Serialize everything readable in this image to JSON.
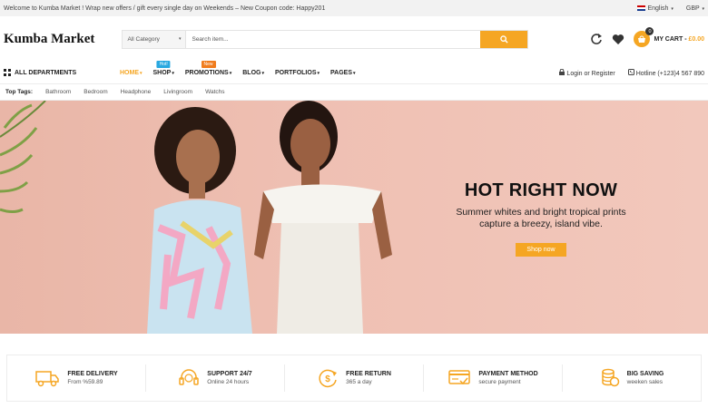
{
  "topbar": {
    "welcome": "Welcome to Kumba Market ! Wrap new offers / gift every single day on Weekends – New Coupon code: Happy201",
    "language": "English",
    "currency": "GBP"
  },
  "header": {
    "logo": "Kumba Market",
    "search_category": "All Category",
    "search_placeholder": "Search item...",
    "cart_count": "0",
    "cart_label": "MY CART - ",
    "cart_price": "£0.00"
  },
  "nav": {
    "all_departments": "ALL DEPARTMENTS",
    "items": [
      {
        "label": "HOME",
        "badge": ""
      },
      {
        "label": "SHOP",
        "badge": "Hot!"
      },
      {
        "label": "PROMOTIONS",
        "badge": "New"
      },
      {
        "label": "BLOG",
        "badge": ""
      },
      {
        "label": "PORTFOLIOS",
        "badge": ""
      },
      {
        "label": "PAGES",
        "badge": ""
      }
    ],
    "login": "Login or Register",
    "hotline": "Hotline (+123)4 567 890"
  },
  "tags": {
    "label": "Top Tags:",
    "items": [
      "Bathroom",
      "Bedroom",
      "Headphone",
      "Livingroom",
      "Watchs"
    ]
  },
  "hero": {
    "title": "HOT RIGHT NOW",
    "subtitle_line1": "Summer whites and bright tropical prints",
    "subtitle_line2": "capture a breezy, island vibe.",
    "button": "Shop now"
  },
  "features": [
    {
      "title": "FREE DELIVERY",
      "sub": "From %59.89",
      "icon": "truck-icon"
    },
    {
      "title": "SUPPORT 24/7",
      "sub": "Online 24 hours",
      "icon": "headset-icon"
    },
    {
      "title": "FREE RETURN",
      "sub": "365 a day",
      "icon": "return-icon"
    },
    {
      "title": "PAYMENT METHOD",
      "sub": "secure payment",
      "icon": "payment-icon"
    },
    {
      "title": "BIG SAVING",
      "sub": "weeken sales",
      "icon": "coins-icon"
    }
  ],
  "colors": {
    "accent": "#f5a623",
    "hero_bg": "#efc0b3"
  }
}
